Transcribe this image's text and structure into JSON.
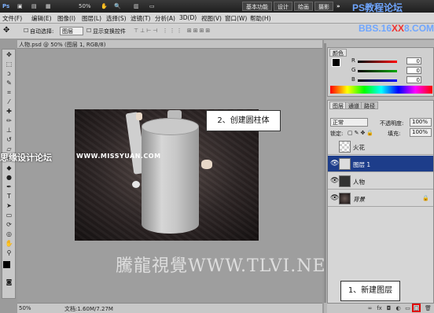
{
  "titlebar": {
    "app_icon": "Ps",
    "zoom": "50%",
    "workspaces": [
      "基本功能",
      "设计",
      "绘画",
      "摄影"
    ],
    "watermark_line1": "PS教程论坛",
    "watermark_line2_a": "BBS.16",
    "watermark_line2_b": "XX",
    "watermark_line2_c": "8.COM"
  },
  "menubar": {
    "items": [
      "文件(F)",
      "编辑(E)",
      "图像(I)",
      "图层(L)",
      "选择(S)",
      "滤镜(T)",
      "分析(A)",
      "3D(D)",
      "视图(V)",
      "窗口(W)",
      "帮助(H)"
    ]
  },
  "optionsbar": {
    "auto_select_label": "自动选择:",
    "auto_select_value": "图层",
    "show_transform_label": "显示变换控件"
  },
  "document": {
    "tab_title": "人物.psd @ 50% (图层 1, RGB/8)",
    "zoom": "50%",
    "doc_info": "文档:1.60M/7.27M"
  },
  "overlays": {
    "callout_create_cylinder": "2、创建圆柱体",
    "callout_new_layer": "1、新建图层",
    "watermark_site_cn": "思缘设计论坛",
    "watermark_site_url": "WWW.MISSYUAN.COM",
    "watermark_bottom": "騰龍視覺WWW.TLVI.NET"
  },
  "color_panel": {
    "tab": "颜色",
    "r_label": "R",
    "r_value": "0",
    "g_label": "G",
    "g_value": "0",
    "b_label": "B",
    "b_value": "0"
  },
  "layers_panel": {
    "tabs": [
      "图层",
      "通道",
      "路径"
    ],
    "blend_mode": "正常",
    "opacity_label": "不透明度:",
    "opacity_value": "100%",
    "lock_label": "锁定:",
    "fill_label": "填充:",
    "fill_value": "100%",
    "layers": [
      {
        "name": "火花",
        "selected": false
      },
      {
        "name": "图层 1",
        "selected": true
      },
      {
        "name": "人物",
        "selected": false
      },
      {
        "name": "背景",
        "selected": false
      }
    ]
  },
  "colors": {
    "highlight_red": "#e00000",
    "selected_layer": "#1d3d8a"
  }
}
